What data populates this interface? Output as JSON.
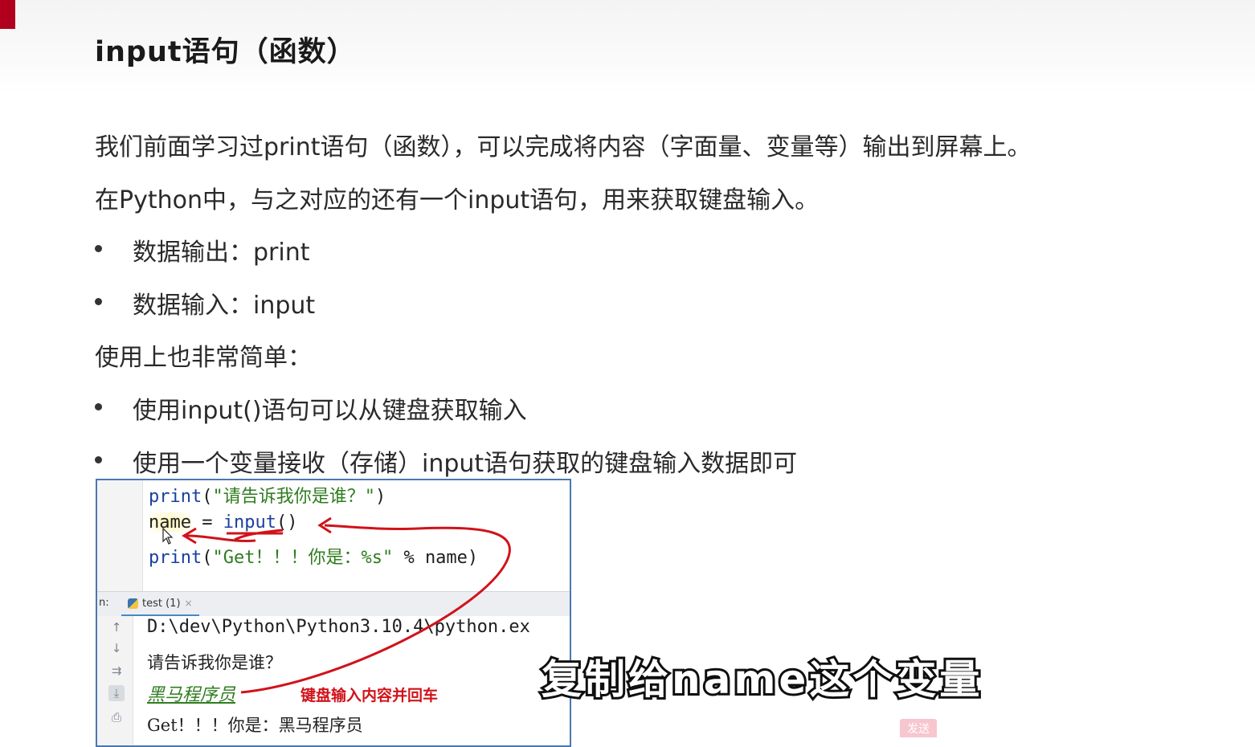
{
  "slide": {
    "title": "input语句（函数）",
    "paragraph1": "我们前面学习过print语句（函数），可以完成将内容（字面量、变量等）输出到屏幕上。",
    "paragraph2": "在Python中，与之对应的还有一个input语句，用来获取键盘输入。",
    "io_bullets": [
      "数据输出：print",
      "数据输入：input"
    ],
    "usage_heading": "使用上也非常简单：",
    "usage_bullets": [
      "使用input()语句可以从键盘获取输入",
      "使用一个变量接收（存储）input语句获取的键盘输入数据即可"
    ]
  },
  "ide": {
    "code": {
      "line1": {
        "func": "print",
        "open": "(",
        "str": "\"请告诉我你是谁？\"",
        "close": ")"
      },
      "line2": {
        "var": "name",
        "op": " = ",
        "func": "input",
        "parens": "()"
      },
      "line3": {
        "func": "print",
        "open": "(",
        "str": "\"Get！！！你是：%s\"",
        "rest": " % name)"
      }
    },
    "run_label": "n:",
    "tab_label": "test (1)",
    "tab_close": "×",
    "console": {
      "path_line": "D:\\dev\\Python\\Python3.10.4\\python.ex",
      "prompt_line": "请告诉我你是谁？",
      "user_input": "黑马程序员",
      "output_line": "Get！！！你是：黑马程序员"
    },
    "toolbar_icons": [
      "arrow-up-icon",
      "arrow-down-icon",
      "soft-wrap-icon",
      "scroll-to-end-icon",
      "print-icon"
    ]
  },
  "annotation": {
    "note": "键盘输入内容并回车",
    "color": "#d1121a"
  },
  "video_subtitle": "复制给name这个变量",
  "send_badge": "发送",
  "colors": {
    "brand_red": "#b0001e",
    "ide_border": "#4a78b0",
    "keyword": "#1a3fa0",
    "string": "#2f7d1f"
  }
}
